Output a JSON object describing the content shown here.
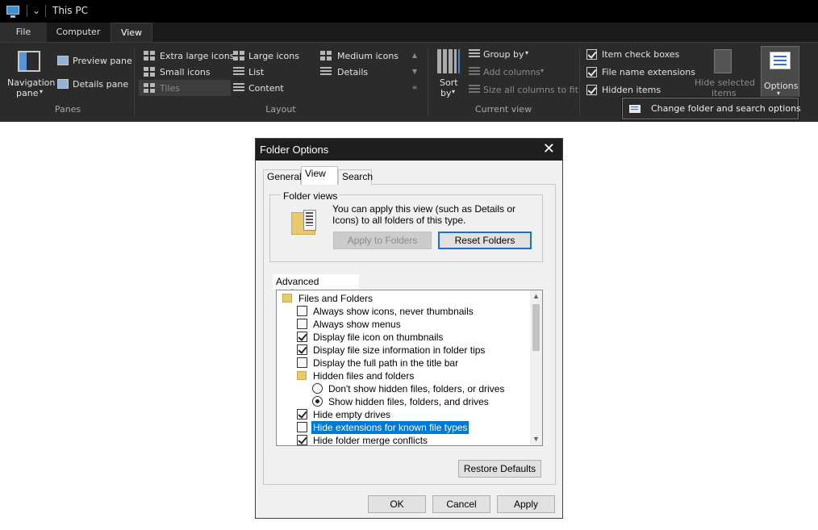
{
  "explorer": {
    "title": "This PC",
    "quick_access": "⌄",
    "tabs": {
      "file": "File",
      "computer": "Computer",
      "view": "View"
    },
    "panes": {
      "navigation_pane": "Navigation",
      "navigation_pane_2": "pane",
      "preview_pane": "Preview pane",
      "details_pane": "Details pane",
      "group_label": "Panes"
    },
    "layout": {
      "extra_large_icons": "Extra large icons",
      "large_icons": "Large icons",
      "medium_icons": "Medium icons",
      "small_icons": "Small icons",
      "list": "List",
      "details": "Details",
      "tiles": "Tiles",
      "content": "Content",
      "group_label": "Layout"
    },
    "current_view": {
      "sort_by": "Sort",
      "sort_by_2": "by",
      "group_by": "Group by",
      "add_columns": "Add columns",
      "size_all_columns": "Size all columns to fit",
      "group_label": "Current view"
    },
    "show_hide": {
      "item_check_boxes": "Item check boxes",
      "file_name_extensions": "File name extensions",
      "hidden_items": "Hidden items",
      "hide_selected_items": "Hide selected",
      "hide_selected_items_2": "items"
    },
    "options_label": "Options",
    "tooltip": "Change folder and search options"
  },
  "dialog": {
    "title": "Folder Options",
    "tabs": {
      "general": "General",
      "view": "View",
      "search": "Search"
    },
    "folder_views": {
      "legend": "Folder views",
      "description": "You can apply this view (such as Details or Icons) to all folders of this type.",
      "apply_to_folders": "Apply to Folders",
      "reset_folders": "Reset Folders"
    },
    "advanced_label": "Advanced settings:",
    "advanced_items": [
      {
        "type": "folder",
        "label": "Files and Folders"
      },
      {
        "type": "checkbox",
        "checked": false,
        "label": "Always show icons, never thumbnails"
      },
      {
        "type": "checkbox",
        "checked": false,
        "label": "Always show menus"
      },
      {
        "type": "checkbox",
        "checked": true,
        "label": "Display file icon on thumbnails"
      },
      {
        "type": "checkbox",
        "checked": true,
        "label": "Display file size information in folder tips"
      },
      {
        "type": "checkbox",
        "checked": false,
        "label": "Display the full path in the title bar"
      },
      {
        "type": "folder",
        "label": "Hidden files and folders"
      },
      {
        "type": "radio",
        "checked": false,
        "label": "Don't show hidden files, folders, or drives"
      },
      {
        "type": "radio",
        "checked": true,
        "label": "Show hidden files, folders, and drives"
      },
      {
        "type": "checkbox",
        "checked": true,
        "label": "Hide empty drives"
      },
      {
        "type": "checkbox",
        "checked": false,
        "selected": true,
        "label": "Hide extensions for known file types"
      },
      {
        "type": "checkbox",
        "checked": true,
        "label": "Hide folder merge conflicts"
      }
    ],
    "restore_defaults": "Restore Defaults",
    "ok": "OK",
    "cancel": "Cancel",
    "apply": "Apply"
  }
}
